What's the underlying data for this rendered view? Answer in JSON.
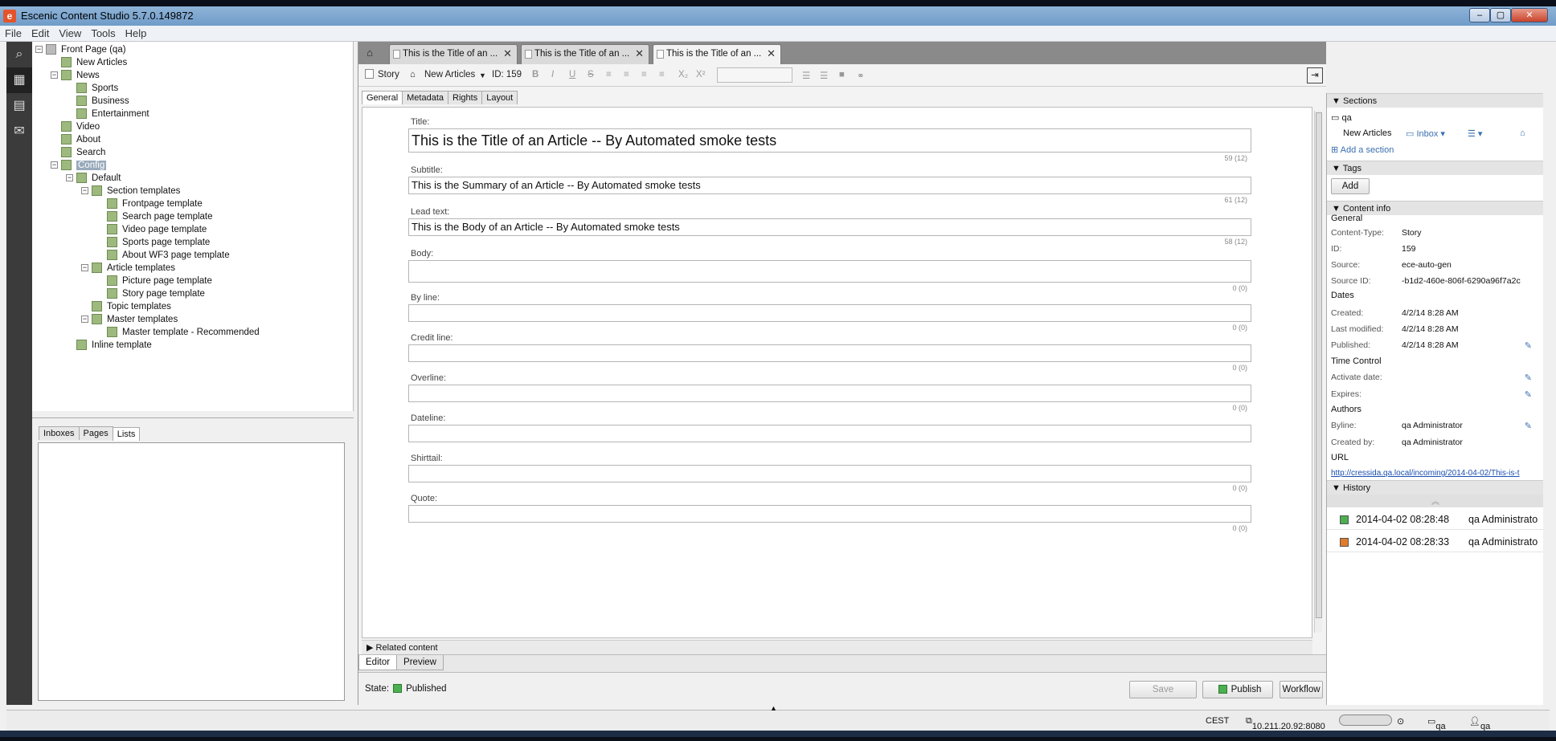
{
  "window": {
    "title": "Escenic Content Studio 5.7.0.149872",
    "app_icon": "escenic-logo-icon"
  },
  "menu": [
    "File",
    "Edit",
    "View",
    "Tools",
    "Help"
  ],
  "tree": [
    {
      "label": "Front Page (qa)",
      "depth": 0,
      "type": "pub",
      "expand": "−"
    },
    {
      "label": "New Articles",
      "depth": 1,
      "expand": ""
    },
    {
      "label": "News",
      "depth": 1,
      "expand": "−"
    },
    {
      "label": "Sports",
      "depth": 2,
      "expand": ""
    },
    {
      "label": "Business",
      "depth": 2,
      "expand": ""
    },
    {
      "label": "Entertainment",
      "depth": 2,
      "expand": ""
    },
    {
      "label": "Video",
      "depth": 1,
      "expand": ""
    },
    {
      "label": "About",
      "depth": 1,
      "expand": ""
    },
    {
      "label": "Search",
      "depth": 1,
      "expand": ""
    },
    {
      "label": "Config",
      "depth": 1,
      "expand": "−",
      "selected": true
    },
    {
      "label": "Default",
      "depth": 2,
      "expand": "−"
    },
    {
      "label": "Section templates",
      "depth": 3,
      "expand": "−"
    },
    {
      "label": "Frontpage template",
      "depth": 4,
      "expand": ""
    },
    {
      "label": "Search page template",
      "depth": 4,
      "expand": ""
    },
    {
      "label": "Video page template",
      "depth": 4,
      "expand": ""
    },
    {
      "label": "Sports page template",
      "depth": 4,
      "expand": ""
    },
    {
      "label": "About WF3 page template",
      "depth": 4,
      "expand": ""
    },
    {
      "label": "Article templates",
      "depth": 3,
      "expand": "−"
    },
    {
      "label": "Picture page template",
      "depth": 4,
      "expand": ""
    },
    {
      "label": "Story page template",
      "depth": 4,
      "expand": ""
    },
    {
      "label": "Topic templates",
      "depth": 3,
      "expand": ""
    },
    {
      "label": "Master templates",
      "depth": 3,
      "expand": "−"
    },
    {
      "label": "Master template - Recommended",
      "depth": 4,
      "expand": ""
    },
    {
      "label": "Inline template",
      "depth": 2,
      "expand": ""
    }
  ],
  "bottom_tabs": [
    "Inboxes",
    "Pages",
    "Lists"
  ],
  "doc_tabs": [
    "This is the Title of an ...",
    "This is the Title of an ...",
    "This is the Title of an ..."
  ],
  "toolbar": {
    "type": "Story",
    "section": "New Articles",
    "id": "ID: 159"
  },
  "form_tabs": [
    "General",
    "Metadata",
    "Rights",
    "Layout"
  ],
  "fields": [
    {
      "label": "Title:",
      "value": "This is the Title of an Article -- By Automated smoke tests",
      "count": "59 (12)",
      "size": "big"
    },
    {
      "label": "Subtitle:",
      "value": "This is the Summary of an Article -- By Automated smoke tests",
      "count": "61 (12)",
      "size": "med"
    },
    {
      "label": "Lead text:",
      "value": "This is the Body of an Article -- By Automated smoke tests",
      "count": "58 (12)",
      "size": "med"
    },
    {
      "label": "Body:",
      "value": "",
      "count": "0 (0)",
      "size": "tall"
    },
    {
      "label": "By line:",
      "value": "",
      "count": "0 (0)",
      "size": "sm"
    },
    {
      "label": "Credit line:",
      "value": "",
      "count": "0 (0)",
      "size": "sm"
    },
    {
      "label": "Overline:",
      "value": "",
      "count": "0 (0)",
      "size": "sm"
    },
    {
      "label": "Dateline:",
      "value": "",
      "count": "",
      "size": "sm"
    },
    {
      "label": "Shirttail:",
      "value": "",
      "count": "0 (0)",
      "size": "sm"
    },
    {
      "label": "Quote:",
      "value": "",
      "count": "0 (0)",
      "size": "sm"
    }
  ],
  "related": "Related content",
  "editor_tabs": [
    "Editor",
    "Preview"
  ],
  "state": {
    "label": "State:",
    "value": "Published"
  },
  "buttons": {
    "save": "Save",
    "publish": "Publish",
    "workflow": "Workflow"
  },
  "right": {
    "sections_head": "Sections",
    "section_name": "qa",
    "section_home": "New Articles",
    "inbox": "Inbox",
    "add_section": "Add a section",
    "tags_head": "Tags",
    "add": "Add",
    "content_info_head": "Content info",
    "general": "General",
    "content_type_k": "Content-Type:",
    "content_type_v": "Story",
    "id_k": "ID:",
    "id_v": "159",
    "source_k": "Source:",
    "source_v": "ece-auto-gen",
    "source_id_k": "Source ID:",
    "source_id_v": "-b1d2-460e-806f-6290a96f7a2c",
    "dates": "Dates",
    "created_k": "Created:",
    "created_v": "4/2/14 8:28 AM",
    "modified_k": "Last modified:",
    "modified_v": "4/2/14 8:28 AM",
    "published_k": "Published:",
    "published_v": "4/2/14 8:28 AM",
    "time_control": "Time Control",
    "activate_k": "Activate date:",
    "expires_k": "Expires:",
    "authors": "Authors",
    "byline_k": "Byline:",
    "byline_v": "qa Administrator",
    "createdby_k": "Created by:",
    "createdby_v": "qa Administrator",
    "url_head": "URL",
    "url": "http://cressida.qa.local/incoming/2014-04-02/This-is-t",
    "history_head": "History",
    "history": [
      {
        "date": "2014-04-02 08:28:48",
        "user": "qa Administrato",
        "color": "#4caf50"
      },
      {
        "date": "2014-04-02 08:28:33",
        "user": "qa Administrato",
        "color": "#e07b2a"
      }
    ]
  },
  "status": {
    "tz": "CEST",
    "server": "10.211.20.92:8080",
    "pub": "qa",
    "user": "qa Administrator"
  }
}
